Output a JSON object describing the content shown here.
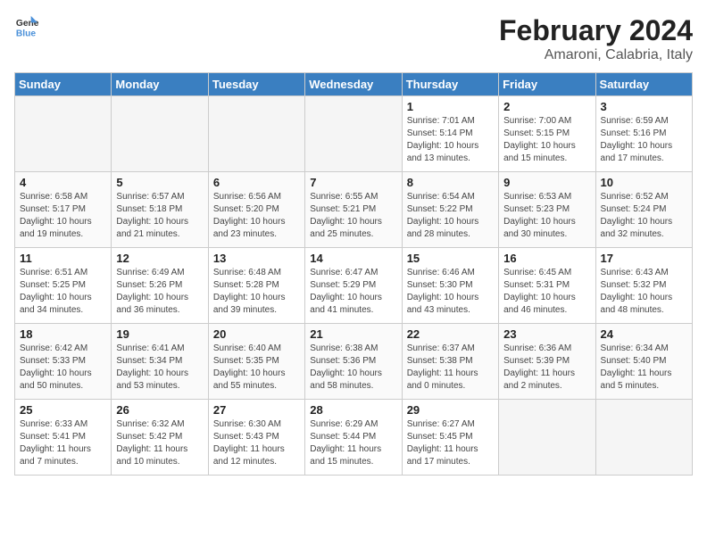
{
  "logo": {
    "line1": "General",
    "line2": "Blue"
  },
  "title": "February 2024",
  "subtitle": "Amaroni, Calabria, Italy",
  "weekdays": [
    "Sunday",
    "Monday",
    "Tuesday",
    "Wednesday",
    "Thursday",
    "Friday",
    "Saturday"
  ],
  "weeks": [
    [
      {
        "num": "",
        "info": ""
      },
      {
        "num": "",
        "info": ""
      },
      {
        "num": "",
        "info": ""
      },
      {
        "num": "",
        "info": ""
      },
      {
        "num": "1",
        "info": "Sunrise: 7:01 AM\nSunset: 5:14 PM\nDaylight: 10 hours\nand 13 minutes."
      },
      {
        "num": "2",
        "info": "Sunrise: 7:00 AM\nSunset: 5:15 PM\nDaylight: 10 hours\nand 15 minutes."
      },
      {
        "num": "3",
        "info": "Sunrise: 6:59 AM\nSunset: 5:16 PM\nDaylight: 10 hours\nand 17 minutes."
      }
    ],
    [
      {
        "num": "4",
        "info": "Sunrise: 6:58 AM\nSunset: 5:17 PM\nDaylight: 10 hours\nand 19 minutes."
      },
      {
        "num": "5",
        "info": "Sunrise: 6:57 AM\nSunset: 5:18 PM\nDaylight: 10 hours\nand 21 minutes."
      },
      {
        "num": "6",
        "info": "Sunrise: 6:56 AM\nSunset: 5:20 PM\nDaylight: 10 hours\nand 23 minutes."
      },
      {
        "num": "7",
        "info": "Sunrise: 6:55 AM\nSunset: 5:21 PM\nDaylight: 10 hours\nand 25 minutes."
      },
      {
        "num": "8",
        "info": "Sunrise: 6:54 AM\nSunset: 5:22 PM\nDaylight: 10 hours\nand 28 minutes."
      },
      {
        "num": "9",
        "info": "Sunrise: 6:53 AM\nSunset: 5:23 PM\nDaylight: 10 hours\nand 30 minutes."
      },
      {
        "num": "10",
        "info": "Sunrise: 6:52 AM\nSunset: 5:24 PM\nDaylight: 10 hours\nand 32 minutes."
      }
    ],
    [
      {
        "num": "11",
        "info": "Sunrise: 6:51 AM\nSunset: 5:25 PM\nDaylight: 10 hours\nand 34 minutes."
      },
      {
        "num": "12",
        "info": "Sunrise: 6:49 AM\nSunset: 5:26 PM\nDaylight: 10 hours\nand 36 minutes."
      },
      {
        "num": "13",
        "info": "Sunrise: 6:48 AM\nSunset: 5:28 PM\nDaylight: 10 hours\nand 39 minutes."
      },
      {
        "num": "14",
        "info": "Sunrise: 6:47 AM\nSunset: 5:29 PM\nDaylight: 10 hours\nand 41 minutes."
      },
      {
        "num": "15",
        "info": "Sunrise: 6:46 AM\nSunset: 5:30 PM\nDaylight: 10 hours\nand 43 minutes."
      },
      {
        "num": "16",
        "info": "Sunrise: 6:45 AM\nSunset: 5:31 PM\nDaylight: 10 hours\nand 46 minutes."
      },
      {
        "num": "17",
        "info": "Sunrise: 6:43 AM\nSunset: 5:32 PM\nDaylight: 10 hours\nand 48 minutes."
      }
    ],
    [
      {
        "num": "18",
        "info": "Sunrise: 6:42 AM\nSunset: 5:33 PM\nDaylight: 10 hours\nand 50 minutes."
      },
      {
        "num": "19",
        "info": "Sunrise: 6:41 AM\nSunset: 5:34 PM\nDaylight: 10 hours\nand 53 minutes."
      },
      {
        "num": "20",
        "info": "Sunrise: 6:40 AM\nSunset: 5:35 PM\nDaylight: 10 hours\nand 55 minutes."
      },
      {
        "num": "21",
        "info": "Sunrise: 6:38 AM\nSunset: 5:36 PM\nDaylight: 10 hours\nand 58 minutes."
      },
      {
        "num": "22",
        "info": "Sunrise: 6:37 AM\nSunset: 5:38 PM\nDaylight: 11 hours\nand 0 minutes."
      },
      {
        "num": "23",
        "info": "Sunrise: 6:36 AM\nSunset: 5:39 PM\nDaylight: 11 hours\nand 2 minutes."
      },
      {
        "num": "24",
        "info": "Sunrise: 6:34 AM\nSunset: 5:40 PM\nDaylight: 11 hours\nand 5 minutes."
      }
    ],
    [
      {
        "num": "25",
        "info": "Sunrise: 6:33 AM\nSunset: 5:41 PM\nDaylight: 11 hours\nand 7 minutes."
      },
      {
        "num": "26",
        "info": "Sunrise: 6:32 AM\nSunset: 5:42 PM\nDaylight: 11 hours\nand 10 minutes."
      },
      {
        "num": "27",
        "info": "Sunrise: 6:30 AM\nSunset: 5:43 PM\nDaylight: 11 hours\nand 12 minutes."
      },
      {
        "num": "28",
        "info": "Sunrise: 6:29 AM\nSunset: 5:44 PM\nDaylight: 11 hours\nand 15 minutes."
      },
      {
        "num": "29",
        "info": "Sunrise: 6:27 AM\nSunset: 5:45 PM\nDaylight: 11 hours\nand 17 minutes."
      },
      {
        "num": "",
        "info": ""
      },
      {
        "num": "",
        "info": ""
      }
    ]
  ]
}
